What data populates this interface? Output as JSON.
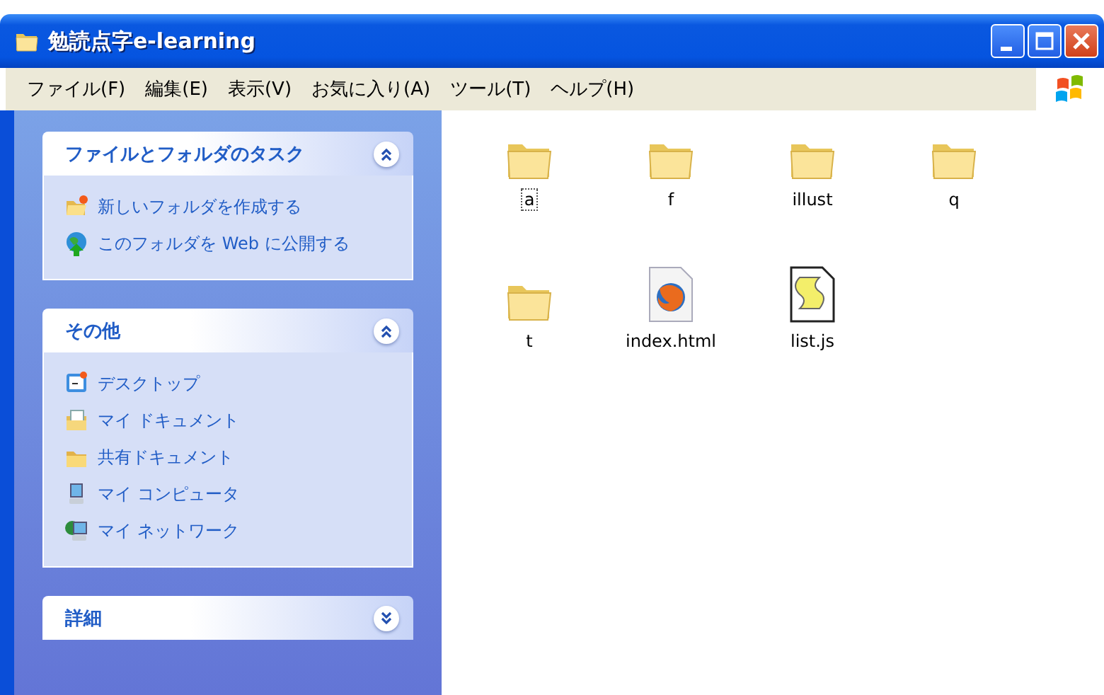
{
  "window": {
    "title": "勉読点字e-learning"
  },
  "menu": [
    "ファイル(F)",
    "編集(E)",
    "表示(V)",
    "お気に入り(A)",
    "ツール(T)",
    "ヘルプ(H)"
  ],
  "sidebar": {
    "panels": [
      {
        "title": "ファイルとフォルダのタスク",
        "expanded": true,
        "items": [
          {
            "label": "新しいフォルダを作成する",
            "kind": "newfolder"
          },
          {
            "label": "このフォルダを Web に公開する",
            "kind": "publish"
          }
        ]
      },
      {
        "title": "その他",
        "expanded": true,
        "items": [
          {
            "label": "デスクトップ",
            "kind": "desktop"
          },
          {
            "label": "マイ ドキュメント",
            "kind": "documents"
          },
          {
            "label": "共有ドキュメント",
            "kind": "folder"
          },
          {
            "label": "マイ コンピュータ",
            "kind": "computer"
          },
          {
            "label": "マイ ネットワーク",
            "kind": "network"
          }
        ]
      },
      {
        "title": "詳細",
        "expanded": false
      }
    ]
  },
  "files": [
    {
      "name": "a",
      "kind": "folder",
      "focused": true
    },
    {
      "name": "f",
      "kind": "folder",
      "focused": false
    },
    {
      "name": "illust",
      "kind": "folder",
      "focused": false
    },
    {
      "name": "q",
      "kind": "folder",
      "focused": false
    },
    {
      "name": "t",
      "kind": "folder",
      "focused": false
    },
    {
      "name": "index.html",
      "kind": "html",
      "focused": false
    },
    {
      "name": "list.js",
      "kind": "script",
      "focused": false
    }
  ]
}
